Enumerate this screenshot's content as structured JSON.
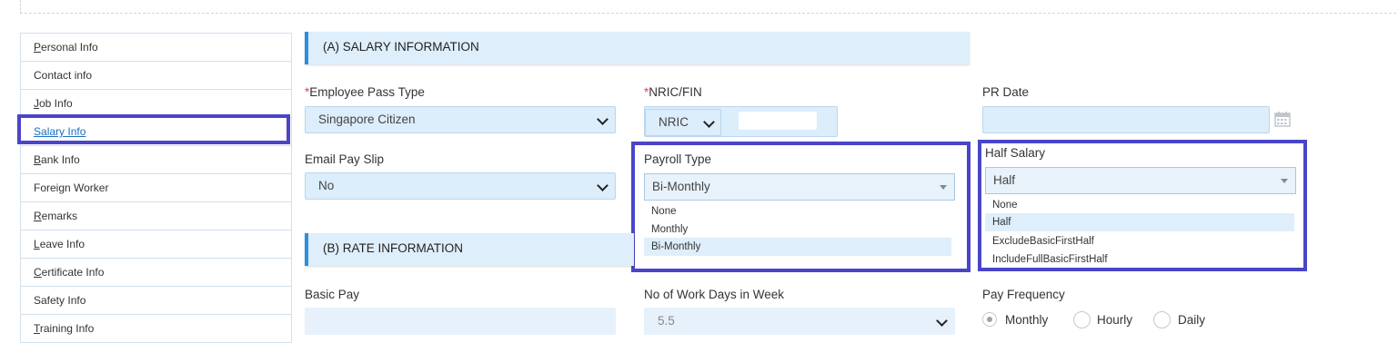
{
  "sidebar": {
    "items": [
      {
        "first": "P",
        "rest": "ersonal Info"
      },
      {
        "first": "",
        "rest": "Contact info"
      },
      {
        "first": "J",
        "rest": "ob Info"
      },
      {
        "first": "S",
        "rest": "alary Info"
      },
      {
        "first": "B",
        "rest": "ank Info"
      },
      {
        "first": "",
        "rest": "Foreign Worker"
      },
      {
        "first": "R",
        "rest": "emarks"
      },
      {
        "first": "L",
        "rest": "eave Info"
      },
      {
        "first": "C",
        "rest": "ertificate Info"
      },
      {
        "first": "",
        "rest": "Safety Info"
      },
      {
        "first": "T",
        "rest": "raining Info"
      }
    ]
  },
  "sections": {
    "salary": "(A) SALARY INFORMATION",
    "rate": "(B) RATE INFORMATION"
  },
  "form": {
    "pass_type_label": "Employee Pass Type",
    "pass_type_value": "Singapore Citizen",
    "nric_label": "NRIC/FIN",
    "nric_type_value": "NRIC",
    "pr_date_label": "PR Date",
    "email_label": "Email Pay Slip",
    "email_value": "No",
    "payroll_label": "Payroll Type",
    "payroll_value": "Bi-Monthly",
    "payroll_options": [
      "None",
      "Monthly",
      "Bi-Monthly"
    ],
    "half_label": "Half Salary",
    "half_value": "Half",
    "half_options": [
      "None",
      "Half",
      "ExcludeBasicFirstHalf",
      "IncludeFullBasicFirstHalf"
    ],
    "basic_pay_label": "Basic Pay",
    "workdays_label": "No of Work Days in Week",
    "workdays_value": "5.5",
    "pay_freq_label": "Pay Frequency",
    "pay_freq_options": [
      "Monthly",
      "Hourly",
      "Daily"
    ],
    "required_mark": "*"
  },
  "colors": {
    "highlight": "#4a45c8",
    "section_bg": "#deeefb",
    "accent": "#2b8fe0"
  }
}
